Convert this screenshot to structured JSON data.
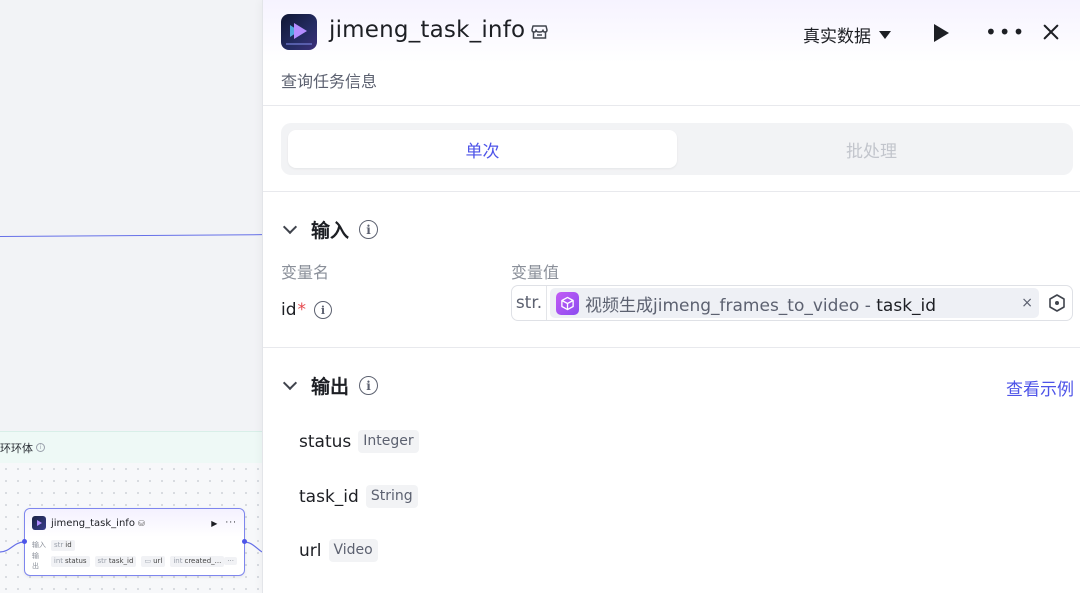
{
  "canvas": {
    "loop_label": "环环体",
    "mini_node": {
      "title": "jimeng_task_info",
      "input_label": "输入",
      "output_label": "输出",
      "inputs": [
        {
          "prefix": "str",
          "name": "id"
        }
      ],
      "outputs": [
        {
          "prefix": "int",
          "name": "status"
        },
        {
          "prefix": "str",
          "name": "task_id"
        },
        {
          "prefix": "",
          "name": "url"
        },
        {
          "prefix": "int",
          "name": "created_..."
        }
      ],
      "more": "···"
    }
  },
  "panel": {
    "title": "jimeng_task_info",
    "subtitle": "查询任务信息",
    "data_source": "真实数据",
    "tabs": [
      {
        "label": "单次",
        "active": true
      },
      {
        "label": "批处理",
        "active": false
      }
    ],
    "input_section": {
      "title": "输入",
      "col_name": "变量名",
      "col_value": "变量值",
      "variable": {
        "name": "id",
        "required_mark": "*",
        "type_prefix": "str.",
        "ref_source": "视频生成jimeng_frames_to_video",
        "ref_sep": " - ",
        "ref_field": "task_id",
        "clear": "×"
      }
    },
    "output_section": {
      "title": "输出",
      "view_example": "查看示例",
      "fields": [
        {
          "name": "status",
          "type": "Integer"
        },
        {
          "name": "task_id",
          "type": "String"
        },
        {
          "name": "url",
          "type": "Video"
        }
      ]
    }
  },
  "colors": {
    "accent": "#4d53e8",
    "required": "#e5484d",
    "muted": "#8a8f99"
  }
}
